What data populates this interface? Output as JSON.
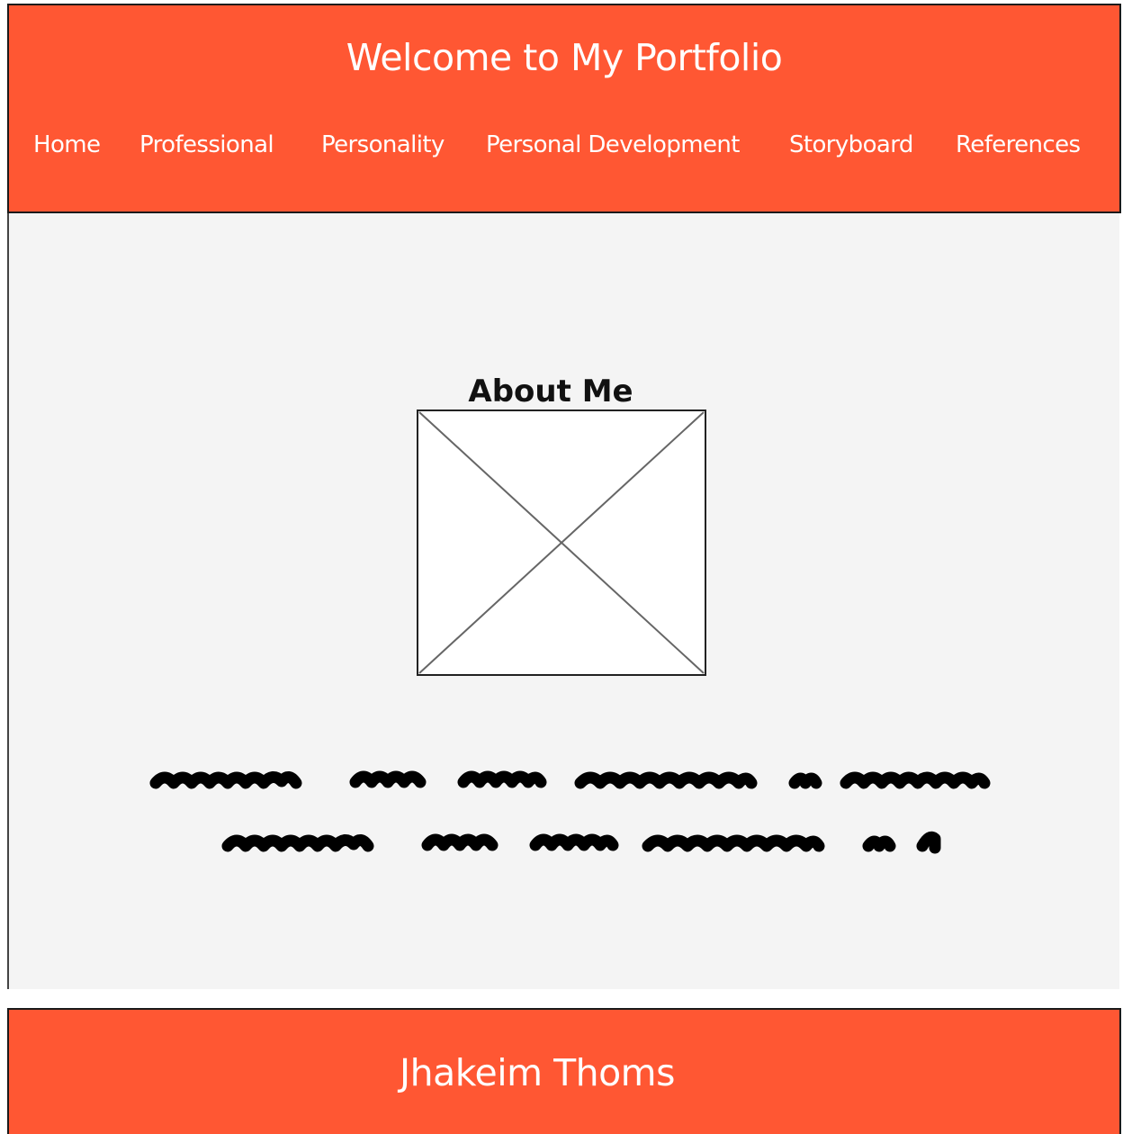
{
  "colors": {
    "accent": "#ff5733",
    "content_bg": "#f4f4f4",
    "text_light": "#ffffff",
    "text_dark": "#111111"
  },
  "header": {
    "title": "Welcome to My Portfolio",
    "nav": [
      {
        "label": "Home"
      },
      {
        "label": "Professional"
      },
      {
        "label": "Personality"
      },
      {
        "label": "Personal Development"
      },
      {
        "label": "Storyboard"
      },
      {
        "label": "References"
      }
    ]
  },
  "main": {
    "section_title": "About Me",
    "image_icon": "image-placeholder-icon",
    "text_placeholder_icon": "scribble-text-placeholder"
  },
  "footer": {
    "name": "Jhakeim Thoms"
  }
}
